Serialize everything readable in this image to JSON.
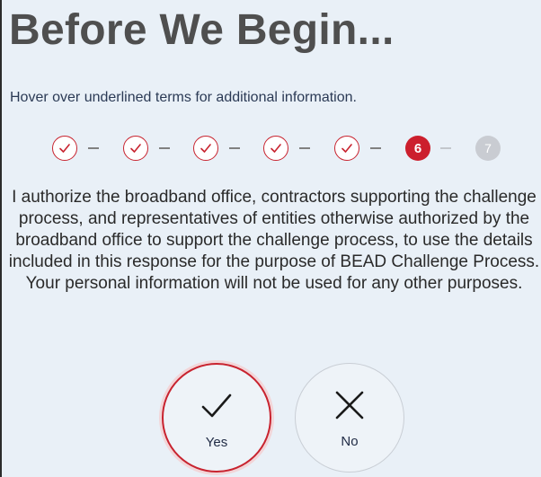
{
  "page": {
    "title": "Before We Begin...",
    "hint": "Hover over underlined terms for additional information."
  },
  "stepper": {
    "steps": [
      {
        "label": "",
        "state": "done"
      },
      {
        "label": "",
        "state": "done"
      },
      {
        "label": "",
        "state": "done"
      },
      {
        "label": "",
        "state": "done"
      },
      {
        "label": "",
        "state": "done"
      },
      {
        "label": "6",
        "state": "current"
      },
      {
        "label": "7",
        "state": "pending"
      }
    ],
    "colors": {
      "accent": "#cc1f2d",
      "pending": "#c9ccd2"
    }
  },
  "consent": {
    "text": "I authorize the broadband office, contractors supporting the challenge process, and representatives of entities otherwise authorized by the broadband office to support the challenge process, to use the details included in this response for the purpose of BEAD Challenge Process. Your personal information will not be used for any other purposes."
  },
  "choices": {
    "yes": {
      "label": "Yes",
      "icon": "check-icon",
      "selected": true
    },
    "no": {
      "label": "No",
      "icon": "x-icon",
      "selected": false
    }
  }
}
